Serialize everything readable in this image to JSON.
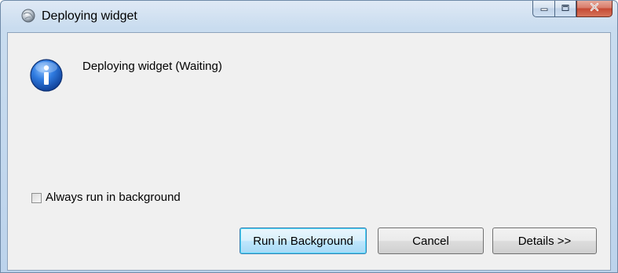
{
  "window": {
    "title": "Deploying widget"
  },
  "icons": {
    "title": "app-globe-icon",
    "message": "info-icon",
    "minimize": "minimize-icon",
    "maximize": "maximize-icon",
    "close": "close-icon"
  },
  "dialog": {
    "message": "Deploying widget (Waiting)",
    "checkbox_label": "Always run in background",
    "checkbox_checked": false
  },
  "buttons": {
    "run_in_background": "Run in Background",
    "cancel": "Cancel",
    "details": "Details >>"
  },
  "colors": {
    "close_button": "#c54a34",
    "info_icon": "#1f5fbf",
    "default_button_border": "#3c7fb1"
  }
}
